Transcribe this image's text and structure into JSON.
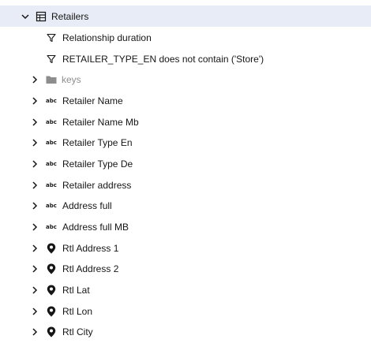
{
  "tree": {
    "root": {
      "label": "Retailers",
      "icon": "table-icon",
      "expanded": true
    },
    "filters": [
      {
        "label": "Relationship duration",
        "icon": "filter-icon"
      },
      {
        "label": "RETAILER_TYPE_EN does not contain ('Store')",
        "icon": "filter-icon"
      }
    ],
    "folder": {
      "label": "keys",
      "icon": "folder-icon",
      "expanded": false
    },
    "fields": [
      {
        "label": "Retailer Name",
        "type_badge": "abc",
        "icon": "text-type-icon"
      },
      {
        "label": "Retailer Name Mb",
        "type_badge": "abc",
        "icon": "text-type-icon"
      },
      {
        "label": "Retailer Type En",
        "type_badge": "abc",
        "icon": "text-type-icon"
      },
      {
        "label": "Retailer Type De",
        "type_badge": "abc",
        "icon": "text-type-icon"
      },
      {
        "label": "Retailer address",
        "type_badge": "abc",
        "icon": "text-type-icon"
      },
      {
        "label": "Address full",
        "type_badge": "abc",
        "icon": "text-type-icon"
      },
      {
        "label": "Address full MB",
        "type_badge": "abc",
        "icon": "text-type-icon"
      },
      {
        "label": "Rtl Address 1",
        "icon": "location-pin-icon"
      },
      {
        "label": "Rtl Address 2",
        "icon": "location-pin-icon"
      },
      {
        "label": "Rtl Lat",
        "icon": "location-pin-icon"
      },
      {
        "label": "Rtl Lon",
        "icon": "location-pin-icon"
      },
      {
        "label": "Rtl City",
        "icon": "location-pin-icon"
      }
    ]
  },
  "colors": {
    "selected_row_bg": "#e8ecf6",
    "text": "#161616",
    "muted_text": "#8d8d8d",
    "folder_icon": "#8d8d8d"
  }
}
